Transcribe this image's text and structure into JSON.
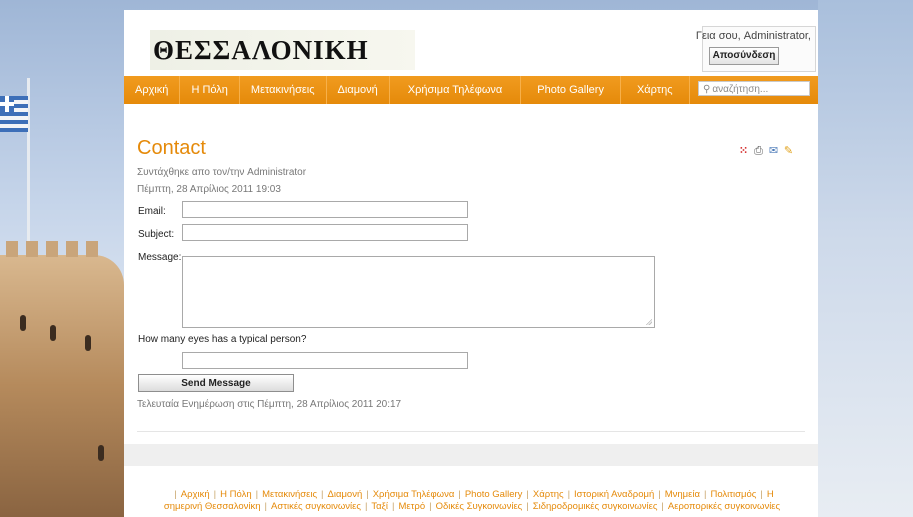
{
  "header": {
    "logo_text": "ΘΕΣΣΑΛΟΝΙΚΗ",
    "greeting": "Γεια σου, Administrator,",
    "logout_label": "Αποσύνδεση"
  },
  "nav": {
    "items": [
      "Αρχική",
      "Η Πόλη",
      "Μετακινήσεις",
      "Διαμονή",
      "Χρήσιμα Τηλέφωνα",
      "Photo Gallery",
      "Χάρτης"
    ],
    "search_placeholder": "αναζήτηση..."
  },
  "article": {
    "title": "Contact",
    "author": "Συντάχθηκε απο τον/την Administrator",
    "date": "Πέμπτη, 28 Απρίλιος 2011 19:03",
    "updated": "Τελευταία Ενημέρωση στις Πέμπτη, 28 Απρίλιος 2011 20:17"
  },
  "form": {
    "email_label": "Email:",
    "subject_label": "Subject:",
    "message_label": "Message:",
    "question": "How many eyes has a typical person?",
    "send_label": "Send Message"
  },
  "icons": {
    "pdf": "pdf-icon",
    "print": "print-icon",
    "email": "email-icon",
    "edit": "edit-icon"
  },
  "footer": {
    "line1": [
      "Αρχική",
      "Η Πόλη",
      "Μετακινήσεις",
      "Διαμονή",
      "Χρήσιμα Τηλέφωνα",
      "Photo Gallery",
      "Χάρτης",
      "Ιστορική Αναδρομή",
      "Μνημεία",
      "Πολιτισμός",
      "Η"
    ],
    "line2": [
      "σημερινή Θεσσαλονίκη",
      "Αστικές συγκοινωνίες",
      "Ταξί",
      "Μετρό",
      "Οδικές Συγκοινωνίες",
      "Σιδηροδρομικές συγκοινωνίες",
      "Αεροπορικές συγκοινωνίες"
    ]
  },
  "colors": {
    "accent": "#e58a0a",
    "nav_bg": "#ef961a"
  }
}
